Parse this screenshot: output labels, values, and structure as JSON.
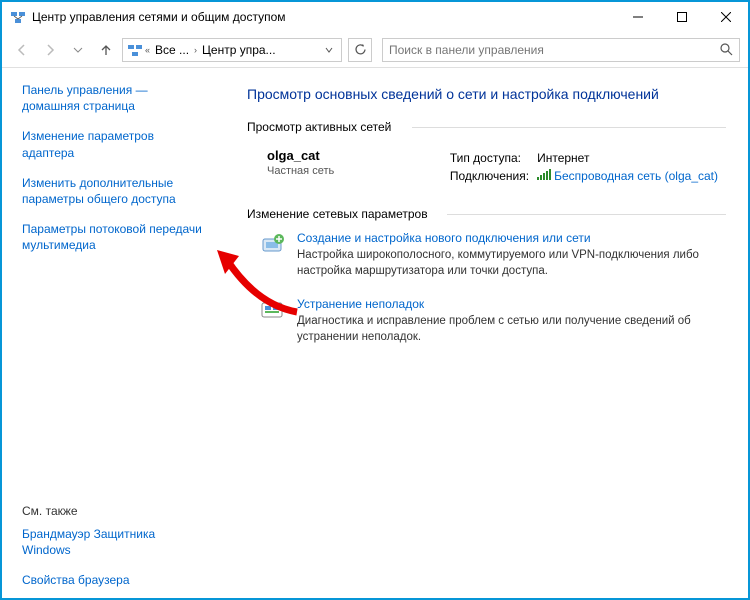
{
  "window": {
    "title": "Центр управления сетями и общим доступом"
  },
  "addressbar": {
    "seg1": "Все ...",
    "seg2": "Центр упра..."
  },
  "search": {
    "placeholder": "Поиск в панели управления"
  },
  "sidebar": {
    "links": [
      "Панель управления — домашняя страница",
      "Изменение параметров адаптера",
      "Изменить дополнительные параметры общего доступа",
      "Параметры потоковой передачи мультимедиа"
    ],
    "see_also_label": "См. также",
    "see_also": [
      "Брандмауэр Защитника Windows",
      "Свойства браузера"
    ]
  },
  "main": {
    "heading": "Просмотр основных сведений о сети и настройка подключений",
    "active_net_heading": "Просмотр активных сетей",
    "net_name": "olga_cat",
    "net_type": "Частная сеть",
    "access_type_label": "Тип доступа:",
    "access_type_value": "Интернет",
    "connections_label": "Подключения:",
    "connections_value": "Беспроводная сеть (olga_cat)",
    "change_heading": "Изменение сетевых параметров",
    "items": [
      {
        "title": "Создание и настройка нового подключения или сети",
        "desc": "Настройка широкополосного, коммутируемого или VPN-подключения либо настройка маршрутизатора или точки доступа."
      },
      {
        "title": "Устранение неполадок",
        "desc": "Диагностика и исправление проблем с сетью или получение сведений об устранении неполадок."
      }
    ]
  }
}
